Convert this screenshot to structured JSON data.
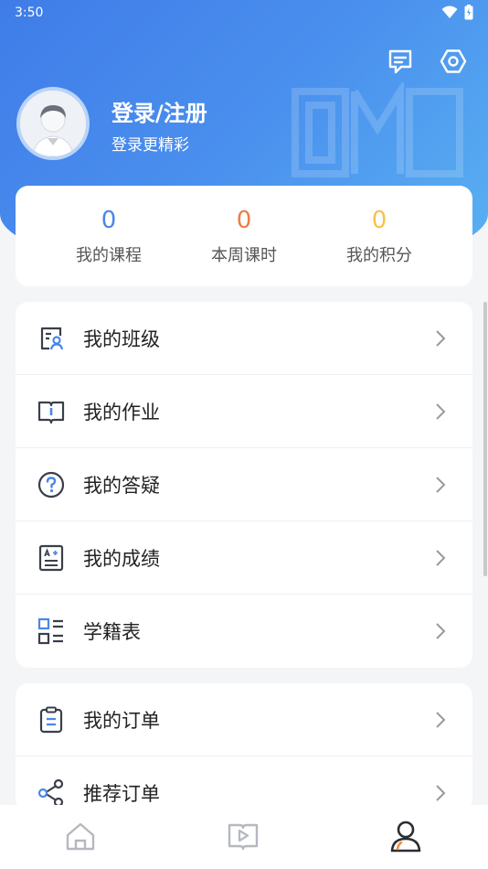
{
  "status_bar": {
    "time": "3:50"
  },
  "header": {
    "login_title": "登录/注册",
    "login_subtitle": "登录更精彩"
  },
  "stats": [
    {
      "value": "0",
      "label": "我的课程",
      "color": "#4a86e8"
    },
    {
      "value": "0",
      "label": "本周课时",
      "color": "#ef7d43"
    },
    {
      "value": "0",
      "label": "我的积分",
      "color": "#f5c24a"
    }
  ],
  "menu_group_1": [
    {
      "label": "我的班级",
      "icon": "class-roster-icon"
    },
    {
      "label": "我的作业",
      "icon": "homework-book-icon"
    },
    {
      "label": "我的答疑",
      "icon": "question-icon"
    },
    {
      "label": "我的成绩",
      "icon": "grade-report-icon"
    },
    {
      "label": "学籍表",
      "icon": "student-record-list-icon"
    }
  ],
  "menu_group_2": [
    {
      "label": "我的订单",
      "icon": "clipboard-order-icon"
    },
    {
      "label": "推荐订单",
      "icon": "share-icon"
    }
  ],
  "tab_bar": [
    {
      "name": "home-tab-icon",
      "active": false
    },
    {
      "name": "video-course-tab-icon",
      "active": false
    },
    {
      "name": "profile-tab-icon",
      "active": true
    }
  ],
  "colors": {
    "header_gradient_start": "#3f7ce8",
    "header_gradient_end": "#5ab2f2",
    "icon_blue": "#4a86e8",
    "icon_dark": "#3a3f4a",
    "active_tab_accent": "#f0923a"
  }
}
